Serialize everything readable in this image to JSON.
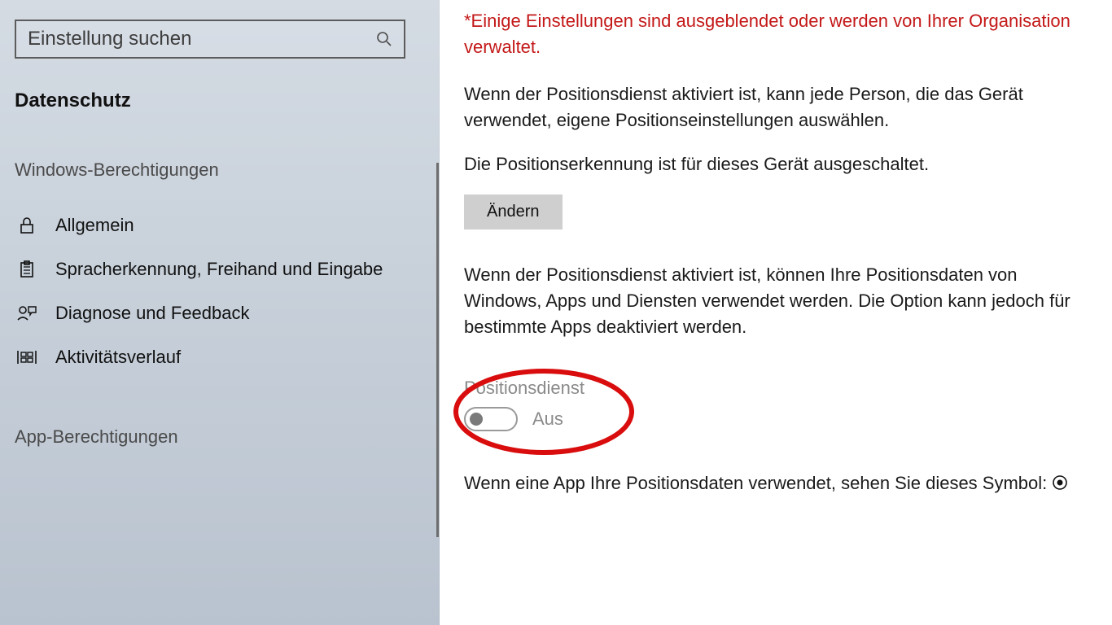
{
  "search": {
    "placeholder": "Einstellung suchen"
  },
  "sidebar": {
    "section_title": "Datenschutz",
    "group1_title": "Windows-Berechtigungen",
    "items": [
      {
        "label": "Allgemein"
      },
      {
        "label": "Spracherkennung, Freihand und Eingabe"
      },
      {
        "label": "Diagnose und Feedback"
      },
      {
        "label": "Aktivitätsverlauf"
      }
    ],
    "group2_title": "App-Berechtigungen"
  },
  "main": {
    "org_warning": "*Einige Einstellungen sind ausgeblendet oder werden von Ihrer Organisation verwaltet.",
    "para1": "Wenn der Positionsdienst aktiviert ist, kann jede Person, die das Gerät verwendet, eigene Positionseinstellungen auswählen.",
    "para2": "Die Positionserkennung ist für dieses Gerät ausgeschaltet.",
    "change_button": "Ändern",
    "para3": "Wenn der Positionsdienst aktiviert ist, können Ihre Positionsdaten von Windows, Apps und Diensten verwendet werden. Die Option kann jedoch für bestimmte Apps deaktiviert werden.",
    "toggle_label": "Positionsdienst",
    "toggle_state": "Aus",
    "para4_prefix": "Wenn eine App Ihre Positionsdaten verwendet, sehen Sie dieses Symbol: "
  }
}
